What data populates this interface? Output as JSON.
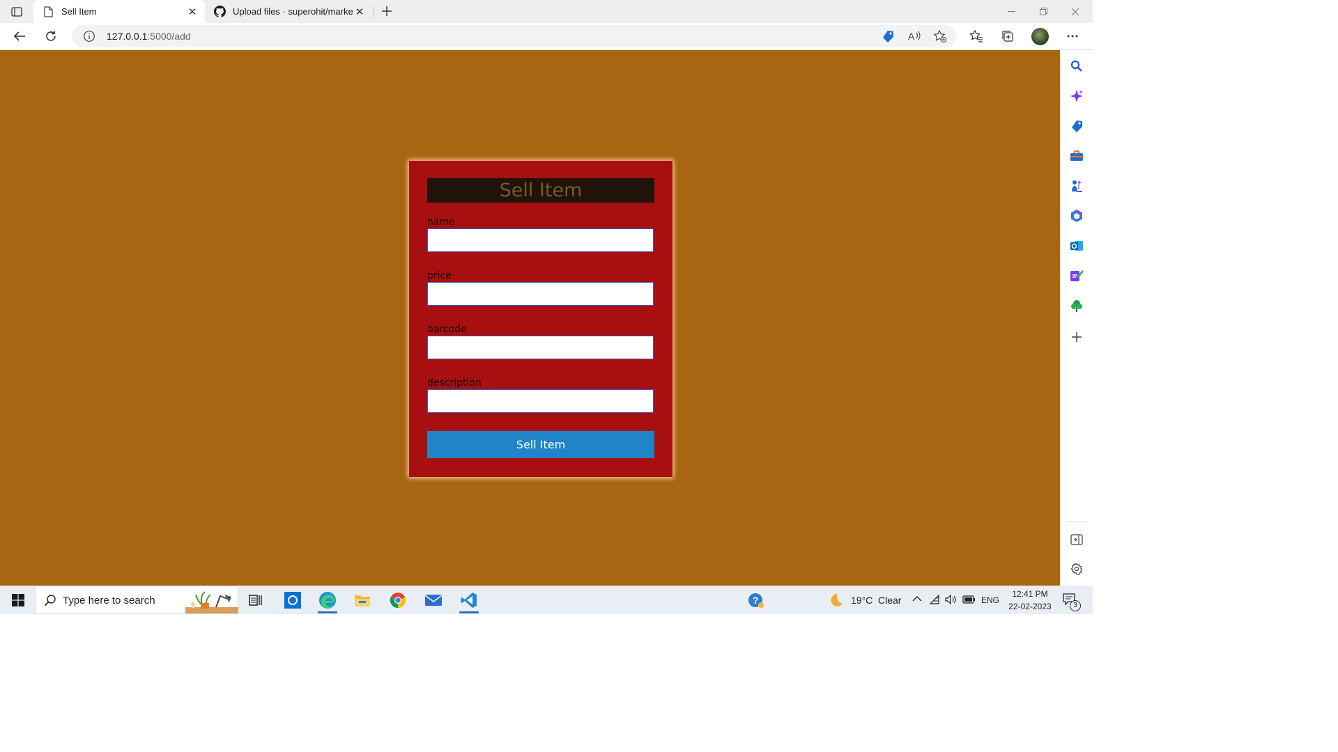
{
  "browser": {
    "tabs": [
      {
        "title": "Sell Item",
        "active": true
      },
      {
        "title": "Upload files · superohit/market",
        "active": false
      }
    ],
    "close_glyph": "✕",
    "url": {
      "host": "127.0.0.1",
      "path": ":5000/add"
    }
  },
  "page": {
    "background": "#a86612",
    "form": {
      "heading": "Sell Item",
      "fields": [
        {
          "label": "name",
          "value": ""
        },
        {
          "label": "price",
          "value": ""
        },
        {
          "label": "barcode",
          "value": ""
        },
        {
          "label": "description",
          "value": ""
        }
      ],
      "submit_label": "Sell Item",
      "colors": {
        "card": "#a70f10",
        "heading_bg": "#1f130a",
        "heading_text": "#7a5a22",
        "button": "#1f84c8"
      }
    }
  },
  "sidebar": {
    "items": [
      "search-icon",
      "copilot-icon",
      "shopping-tag-icon",
      "tools-icon",
      "games-icon",
      "office-icon",
      "outlook-icon",
      "designer-icon",
      "tree-icon",
      "add-icon",
      "hide-sidebar-icon",
      "settings-icon"
    ]
  },
  "taskbar": {
    "search_placeholder": "Type here to search",
    "apps": [
      "task-view-icon",
      "photo-app-icon",
      "edge-icon",
      "file-explorer-icon",
      "chrome-icon",
      "mail-icon",
      "vscode-icon"
    ],
    "weather": {
      "temp": "19°C",
      "condition": "Clear"
    },
    "language": "ENG",
    "time": "12:41 PM",
    "date": "22-02-2023",
    "notification_count": "3"
  }
}
